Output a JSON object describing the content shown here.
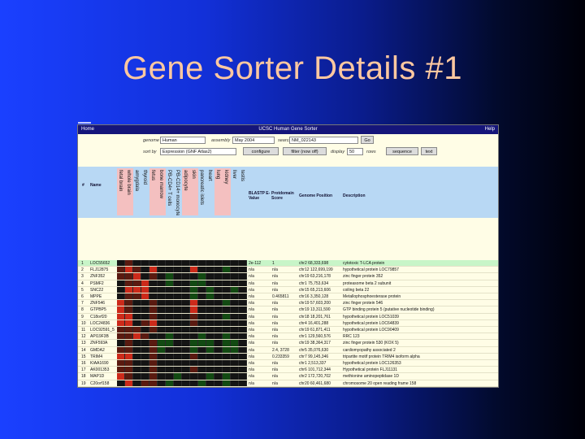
{
  "slide": {
    "title": "Gene Sorter Details #1"
  },
  "window": {
    "left_label": "Home",
    "title": "UCSC Human Gene Sorter",
    "right_label": "Help"
  },
  "controls": {
    "genome_label": "genome",
    "genome_value": "Human",
    "assembly_label": "assembly",
    "assembly_value": "May 2004",
    "search_label": "search",
    "search_value": "NM_022143",
    "go_label": "Go",
    "sort_label": "sort by",
    "sort_value": "Expression (GNF Atlas2)",
    "configure_label": "configure",
    "filter_label": "filter (now off)",
    "display_label": "display",
    "display_value": "50",
    "rows_label": "rows",
    "sequence_label": "sequence",
    "text_label": "text"
  },
  "columns": {
    "num": "#",
    "name": "Name",
    "tissues": [
      "fetal brain",
      "whole brain",
      "amygdala",
      "thyroid",
      "fetus",
      "bone marrow",
      "PB-CD4+ T cells",
      "PB-CD14+ monocytes",
      "adipocyte",
      "skin",
      "pancreatic islets",
      "heart",
      "lung",
      "kidney",
      "liver",
      "testis"
    ],
    "blast": "BLASTP E-Value",
    "pfam": "Protdomain Score",
    "pos": "Genome Position",
    "desc": "Description"
  },
  "heat_colors": {
    "red": "#cc2a1a",
    "dark_red": "#5a1a10",
    "black": "#141414",
    "dark_green": "#124a12",
    "green": "#22a022"
  },
  "rows": [
    {
      "n": "1",
      "name": "LOC55652",
      "blast": "2e-112",
      "pfam": "1",
      "pos": "chr2 68,333,698",
      "desc": "cytotoxic T-LCA protein",
      "hl": true,
      "heat": [
        0,
        1,
        0,
        0,
        0,
        0,
        0,
        0,
        0,
        0,
        0,
        0,
        0,
        0,
        0,
        0
      ]
    },
    {
      "n": "2",
      "name": "FLJ12875",
      "blast": "n/a",
      "pfam": "n/a",
      "pos": "chr12 122,699,199",
      "desc": "hypothetical protein LOC79857",
      "heat": [
        1,
        2,
        1,
        0,
        2,
        0,
        0,
        0,
        0,
        2,
        0,
        0,
        0,
        -1,
        0,
        0
      ]
    },
    {
      "n": "3",
      "name": "ZNF352",
      "blast": "n/a",
      "pfam": "n/a",
      "pos": "chr19 63,216,178",
      "desc": "zinc finger protein 352",
      "heat": [
        1,
        1,
        2,
        0,
        1,
        0,
        -1,
        0,
        0,
        0,
        -1,
        0,
        0,
        0,
        0,
        0
      ]
    },
    {
      "n": "4",
      "name": "PSMF2",
      "blast": "n/a",
      "pfam": "n/a",
      "pos": "chr1 75,753,634",
      "desc": "proteasome beta 2 subunit",
      "heat": [
        0,
        1,
        1,
        2,
        0,
        0,
        -1,
        0,
        0,
        -1,
        -1,
        0,
        0,
        0,
        0,
        0
      ]
    },
    {
      "n": "5",
      "name": "SNC22",
      "blast": "n/a",
      "pfam": "n/a",
      "pos": "chr15 65,213,606",
      "desc": "coiling beta 22",
      "heat": [
        0,
        2,
        2,
        2,
        0,
        0,
        0,
        0,
        0,
        -1,
        0,
        -1,
        0,
        0,
        -1,
        0
      ]
    },
    {
      "n": "6",
      "name": "MPPE",
      "blast": "n/a",
      "pfam": "0.465811",
      "pos": "chr16 3,350,128",
      "desc": "Metallophosphoesterase protein",
      "heat": [
        0,
        1,
        1,
        2,
        0,
        0,
        0,
        0,
        0,
        -1,
        0,
        -1,
        0,
        0,
        0,
        0
      ]
    },
    {
      "n": "7",
      "name": "ZNF546",
      "blast": "n/a",
      "pfam": "n/a",
      "pos": "chr19 57,603,200",
      "desc": "zinc finger protein 546",
      "heat": [
        2,
        1,
        0,
        0,
        1,
        0,
        0,
        0,
        0,
        2,
        0,
        0,
        0,
        -1,
        0,
        0
      ]
    },
    {
      "n": "8",
      "name": "GTPBP5",
      "blast": "n/a",
      "pfam": "n/a",
      "pos": "chr19 13,311,590",
      "desc": "GTP binding protein 5 (putative nucleotide binding)",
      "heat": [
        2,
        1,
        0,
        0,
        1,
        0,
        0,
        0,
        0,
        2,
        0,
        0,
        0,
        0,
        0,
        0
      ]
    },
    {
      "n": "9",
      "name": "C18orf20",
      "blast": "n/a",
      "pfam": "n/a",
      "pos": "chr18 18,201,761",
      "desc": "hypothetical protein LOC51039",
      "heat": [
        2,
        2,
        0,
        0,
        1,
        0,
        0,
        0,
        0,
        1,
        0,
        0,
        0,
        -1,
        0,
        0
      ]
    },
    {
      "n": "10",
      "name": "LOC24836",
      "blast": "n/a",
      "pfam": "n/a",
      "pos": "chr4 16,401,288",
      "desc": "hypothetical protein LOC64839",
      "heat": [
        2,
        2,
        0,
        1,
        2,
        0,
        0,
        0,
        0,
        1,
        0,
        0,
        0,
        0,
        0,
        0
      ]
    },
    {
      "n": "11",
      "name": "LOC92591_5",
      "blast": "n/a",
      "pfam": "n/a",
      "pos": "chr19 61,871,411",
      "desc": "hypothetical protein LOC90409",
      "heat": [
        1,
        1,
        1,
        0,
        1,
        0,
        0,
        0,
        0,
        0,
        0,
        0,
        0,
        0,
        0,
        0
      ]
    },
    {
      "n": "12",
      "name": "API19F3B",
      "blast": "n/a",
      "pfam": "n/a",
      "pos": "chr1 129,560,576",
      "desc": "RRC 123",
      "heat": [
        1,
        1,
        2,
        1,
        0,
        0,
        -1,
        0,
        0,
        0,
        -1,
        0,
        0,
        -1,
        0,
        0
      ]
    },
    {
      "n": "13",
      "name": "ZNF593A",
      "blast": "n/a",
      "pfam": "n/a",
      "pos": "chr19 38,364,317",
      "desc": "zinc finger protein 530 (KOX 5)",
      "heat": [
        0,
        1,
        0,
        0,
        1,
        -1,
        -1,
        0,
        0,
        -1,
        -1,
        -1,
        0,
        -1,
        -1,
        0
      ]
    },
    {
      "n": "14",
      "name": "GMDA2",
      "blast": "n/a",
      "pfam": "2.4, 3728",
      "pos": "chr5 35,076,630",
      "desc": "cardiomyopathy associated 2",
      "heat": [
        1,
        1,
        0,
        0,
        1,
        -1,
        0,
        0,
        0,
        -1,
        0,
        -1,
        0,
        -1,
        -1,
        0
      ]
    },
    {
      "n": "15",
      "name": "TRIM4",
      "blast": "n/a",
      "pfam": "0.233359",
      "pos": "chr7 99,145,346",
      "desc": "tripartite motif protein TRIM4 isoform alpha",
      "heat": [
        2,
        2,
        0,
        0,
        1,
        0,
        0,
        0,
        0,
        1,
        0,
        0,
        0,
        0,
        0,
        0
      ]
    },
    {
      "n": "16",
      "name": "KIAA1690",
      "blast": "n/a",
      "pfam": "n/a",
      "pos": "chr1 2,513,337",
      "desc": "hypothetical protein LOC126353",
      "heat": [
        1,
        1,
        0,
        0,
        1,
        0,
        0,
        0,
        0,
        0,
        0,
        0,
        0,
        0,
        0,
        0
      ]
    },
    {
      "n": "17",
      "name": "AK001353",
      "blast": "n/a",
      "pfam": "n/a",
      "pos": "chr6 101,712,344",
      "desc": "Hypothetical protein FLJ11131",
      "heat": [
        1,
        1,
        0,
        0,
        1,
        0,
        0,
        0,
        0,
        1,
        0,
        0,
        0,
        0,
        0,
        0
      ]
    },
    {
      "n": "18",
      "name": "MAP1D",
      "blast": "n/a",
      "pfam": "n/a",
      "pos": "chr2 172,720,702",
      "desc": "methionine aminopeptidase 1D",
      "heat": [
        2,
        1,
        0,
        0,
        1,
        0,
        0,
        -1,
        0,
        0,
        0,
        -1,
        0,
        -1,
        0,
        0
      ]
    },
    {
      "n": "19",
      "name": "C20orf158",
      "blast": "n/a",
      "pfam": "n/a",
      "pos": "chr20 60,461,680",
      "desc": "chromosome 20 open reading frame 158",
      "heat": [
        0,
        2,
        0,
        1,
        1,
        0,
        -1,
        0,
        0,
        0,
        -1,
        0,
        0,
        -1,
        0,
        0
      ]
    },
    {
      "n": "20",
      "name": "GDIH1",
      "blast": "n/a",
      "pfam": "n/a",
      "pos": "chr6 67,241,202",
      "desc": "oligophrenin 1",
      "heat": [
        2,
        2,
        0,
        0,
        1,
        0,
        0,
        0,
        0,
        -1,
        0,
        0,
        0,
        0,
        0,
        0
      ]
    },
    {
      "n": "21",
      "name": "SLC25A2",
      "blast": "n/a",
      "pfam": "n/a",
      "pos": "chr5 140,453,623",
      "desc": "solute carrier family 25, member 2 isoform a",
      "heat": [
        2,
        2,
        0,
        0,
        1,
        0,
        0,
        0,
        0,
        0,
        0,
        0,
        0,
        0,
        0,
        0
      ]
    }
  ]
}
